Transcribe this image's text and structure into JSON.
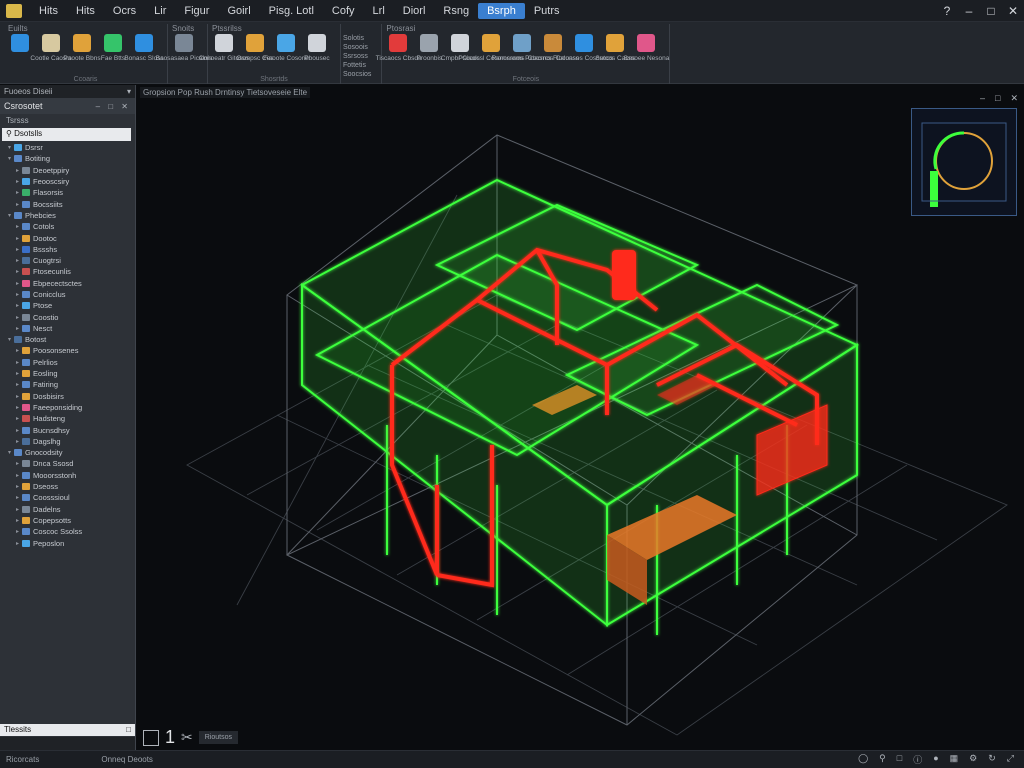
{
  "menu": {
    "items": [
      "Hits",
      "Hits",
      "Ocrs",
      "Lir",
      "Figur",
      "Goirl",
      "Pisg. Lotl",
      "Cofy",
      "Lrl",
      "Diorl",
      "Rsng",
      "Bsrph",
      "Putrs"
    ],
    "active_index": 11
  },
  "ribbon": {
    "groups": [
      {
        "title": "Euilts",
        "foot": "Ccoaris",
        "buttons": [
          {
            "label": "",
            "icon": "search-icon",
            "color": "#2f8fe0"
          },
          {
            "label": "Cootle Caosrs",
            "icon": "document-icon",
            "color": "#d7c9a0"
          },
          {
            "label": "Paoote Bbns",
            "icon": "folder-icon",
            "color": "#e0a23a"
          },
          {
            "label": "Fae Btts",
            "icon": "close-icon",
            "color": "#35c46a"
          },
          {
            "label": "Bonasc Sloss",
            "icon": "pen-icon",
            "color": "#2f8fe0"
          }
        ]
      },
      {
        "title": "Snoits",
        "foot": "",
        "buttons": [
          {
            "label": "Baosasaea Picalnis",
            "icon": "globe-icon",
            "color": "#7a8796"
          }
        ]
      },
      {
        "title": "Ptssrilss",
        "foot": "Shosrtds",
        "buttons": [
          {
            "label": "Conoeatr Gitosos",
            "icon": "triangle-icon",
            "color": "#d0d4da"
          },
          {
            "label": "Osmpsc Ces",
            "icon": "sphere-icon",
            "color": "#e0a23a"
          },
          {
            "label": "Fiaoote Cosorie",
            "icon": "cube-icon",
            "color": "#4aa6e6"
          },
          {
            "label": "Pbousec",
            "icon": "wrench-icon",
            "color": "#d0d4da"
          }
        ]
      },
      {
        "title": "",
        "foot": "",
        "small": [
          "Solotis",
          "Sosoois",
          "Ssrsoss",
          "Fottetis",
          "Soocsios"
        ]
      },
      {
        "title": "Ptosrasi",
        "foot": "Fotceois",
        "buttons": [
          {
            "label": "Tiscaocs Cbsds",
            "icon": "block-icon",
            "color": "#e23b3b"
          },
          {
            "label": "Proonbis",
            "icon": "cube-icon",
            "color": "#9aa3ad"
          },
          {
            "label": "Cmpbr Cisols",
            "icon": "page-icon",
            "color": "#d0d4da"
          },
          {
            "label": "Psococsl Cosomsrems",
            "icon": "edit-icon",
            "color": "#e0a23a"
          },
          {
            "label": "Rsnocssos Picacmos",
            "icon": "globe-icon",
            "color": "#6fa0c8"
          },
          {
            "label": "Cbcsrcs Flocunss",
            "icon": "box-icon",
            "color": "#c98a3a"
          },
          {
            "label": "Caloasos Coscsoos",
            "icon": "cube-icon",
            "color": "#2f8fe0"
          },
          {
            "label": "Sutcos Cacns",
            "icon": "image-icon",
            "color": "#e0a23a"
          },
          {
            "label": "Sssoee Nesona",
            "icon": "grid-icon",
            "color": "#e0578a"
          }
        ]
      }
    ]
  },
  "left_panel": {
    "header": "Fuoeos Diseii",
    "title": "Csrosotet",
    "subtitle": "Tsrsss",
    "selected": "Dsotslls",
    "footer": "Tlessits",
    "tree": [
      {
        "label": "Dsrsr",
        "level": 1,
        "color": "#4aa6e6"
      },
      {
        "label": "Botiting",
        "level": 1,
        "color": "#5a88c8"
      },
      {
        "label": "Deoetppiry",
        "level": 2,
        "color": "#7a8796"
      },
      {
        "label": "Feooscsiry",
        "level": 2,
        "color": "#4aa6e6"
      },
      {
        "label": "Flasorsis",
        "level": 2,
        "color": "#3ab06a"
      },
      {
        "label": "Bocssiits",
        "level": 2,
        "color": "#5a88c8"
      },
      {
        "label": "Phebcies",
        "level": 1,
        "color": "#5a88c8"
      },
      {
        "label": "Cotols",
        "level": 2,
        "color": "#5a88c8"
      },
      {
        "label": "Dootoc",
        "level": 2,
        "color": "#e0a23a"
      },
      {
        "label": "Bssshs",
        "level": 2,
        "color": "#3a6fc8"
      },
      {
        "label": "Cuogtrsi",
        "level": 2,
        "color": "#4a6e9a"
      },
      {
        "label": "Ftosecunlis",
        "level": 2,
        "color": "#c95050"
      },
      {
        "label": "Ebpecectsctes",
        "level": 2,
        "color": "#e0578a"
      },
      {
        "label": "Conicclus",
        "level": 2,
        "color": "#5a88c8"
      },
      {
        "label": "Ptose",
        "level": 2,
        "color": "#4aa6e6"
      },
      {
        "label": "Coostio",
        "level": 2,
        "color": "#7a8796"
      },
      {
        "label": "Nesct",
        "level": 2,
        "color": "#5a88c8"
      },
      {
        "label": "Botost",
        "level": 1,
        "color": "#4a6e9a"
      },
      {
        "label": "Poosonsenes",
        "level": 2,
        "color": "#e0a23a"
      },
      {
        "label": "Pelrlios",
        "level": 2,
        "color": "#5a88c8"
      },
      {
        "label": "Eosling",
        "level": 2,
        "color": "#e0a23a"
      },
      {
        "label": "Fatiring",
        "level": 2,
        "color": "#5a88c8"
      },
      {
        "label": "Dosbisirs",
        "level": 2,
        "color": "#e0a23a"
      },
      {
        "label": "Faeeponsiding",
        "level": 2,
        "color": "#e0578a"
      },
      {
        "label": "Hadsteng",
        "level": 2,
        "color": "#c95050"
      },
      {
        "label": "Bucnsdhsy",
        "level": 2,
        "color": "#5a88c8"
      },
      {
        "label": "Dagslhg",
        "level": 2,
        "color": "#4a6e9a"
      },
      {
        "label": "Gnocodsity",
        "level": 1,
        "color": "#5a88c8"
      },
      {
        "label": "Dnca Ssosd",
        "level": 2,
        "color": "#7a8796"
      },
      {
        "label": "Mooorsstonh",
        "level": 2,
        "color": "#5a88c8"
      },
      {
        "label": "Dseoss",
        "level": 2,
        "color": "#e0a23a"
      },
      {
        "label": "Coosssioul",
        "level": 2,
        "color": "#5a88c8"
      },
      {
        "label": "Dadelns",
        "level": 2,
        "color": "#7a8796"
      },
      {
        "label": "Copepsotts",
        "level": 2,
        "color": "#e0a23a"
      },
      {
        "label": "Coscoc Ssolss",
        "level": 2,
        "color": "#5a88c8"
      },
      {
        "label": "Peposlon",
        "level": 2,
        "color": "#4aa6e6"
      }
    ]
  },
  "viewport": {
    "label": "Gropsion Pop Rush Drntinsy Tietsoveseie Elte",
    "view_number": "1",
    "status_tag": "Rioutsos"
  },
  "statusbar": {
    "left": "Ricorcats",
    "center": "Onneq Deoots"
  },
  "colors": {
    "frame_green": "#3cff3c",
    "pipe_red": "#ff2a1a",
    "accent_blue": "#3a7fd0"
  }
}
